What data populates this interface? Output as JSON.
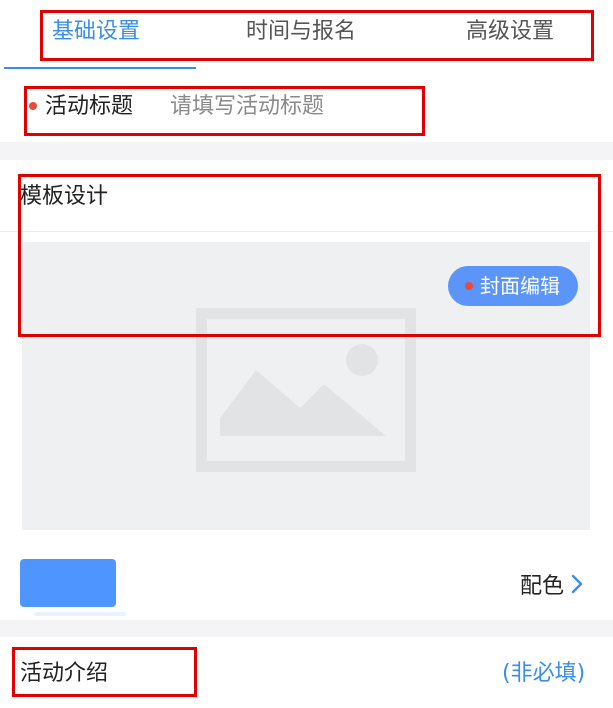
{
  "tabs": [
    {
      "label": "基础设置",
      "active": true
    },
    {
      "label": "时间与报名",
      "active": false
    },
    {
      "label": "高级设置",
      "active": false
    }
  ],
  "title_field": {
    "label": "活动标题",
    "placeholder": "请填写活动标题",
    "value": ""
  },
  "template": {
    "title": "模板设计",
    "cover_button": "封面编辑",
    "image_icon": "image-placeholder-icon",
    "color_label": "配色",
    "color_chevron_icon": "chevron-right-icon",
    "selected_color": "#4f95ff"
  },
  "intro": {
    "title": "活动介绍",
    "optional_label": "(非必填)"
  },
  "colors": {
    "accent": "#3a8ee6",
    "required_dot": "#e84a3c",
    "cover_button_bg": "#5b95f9",
    "annotation_box": "#e00000"
  }
}
